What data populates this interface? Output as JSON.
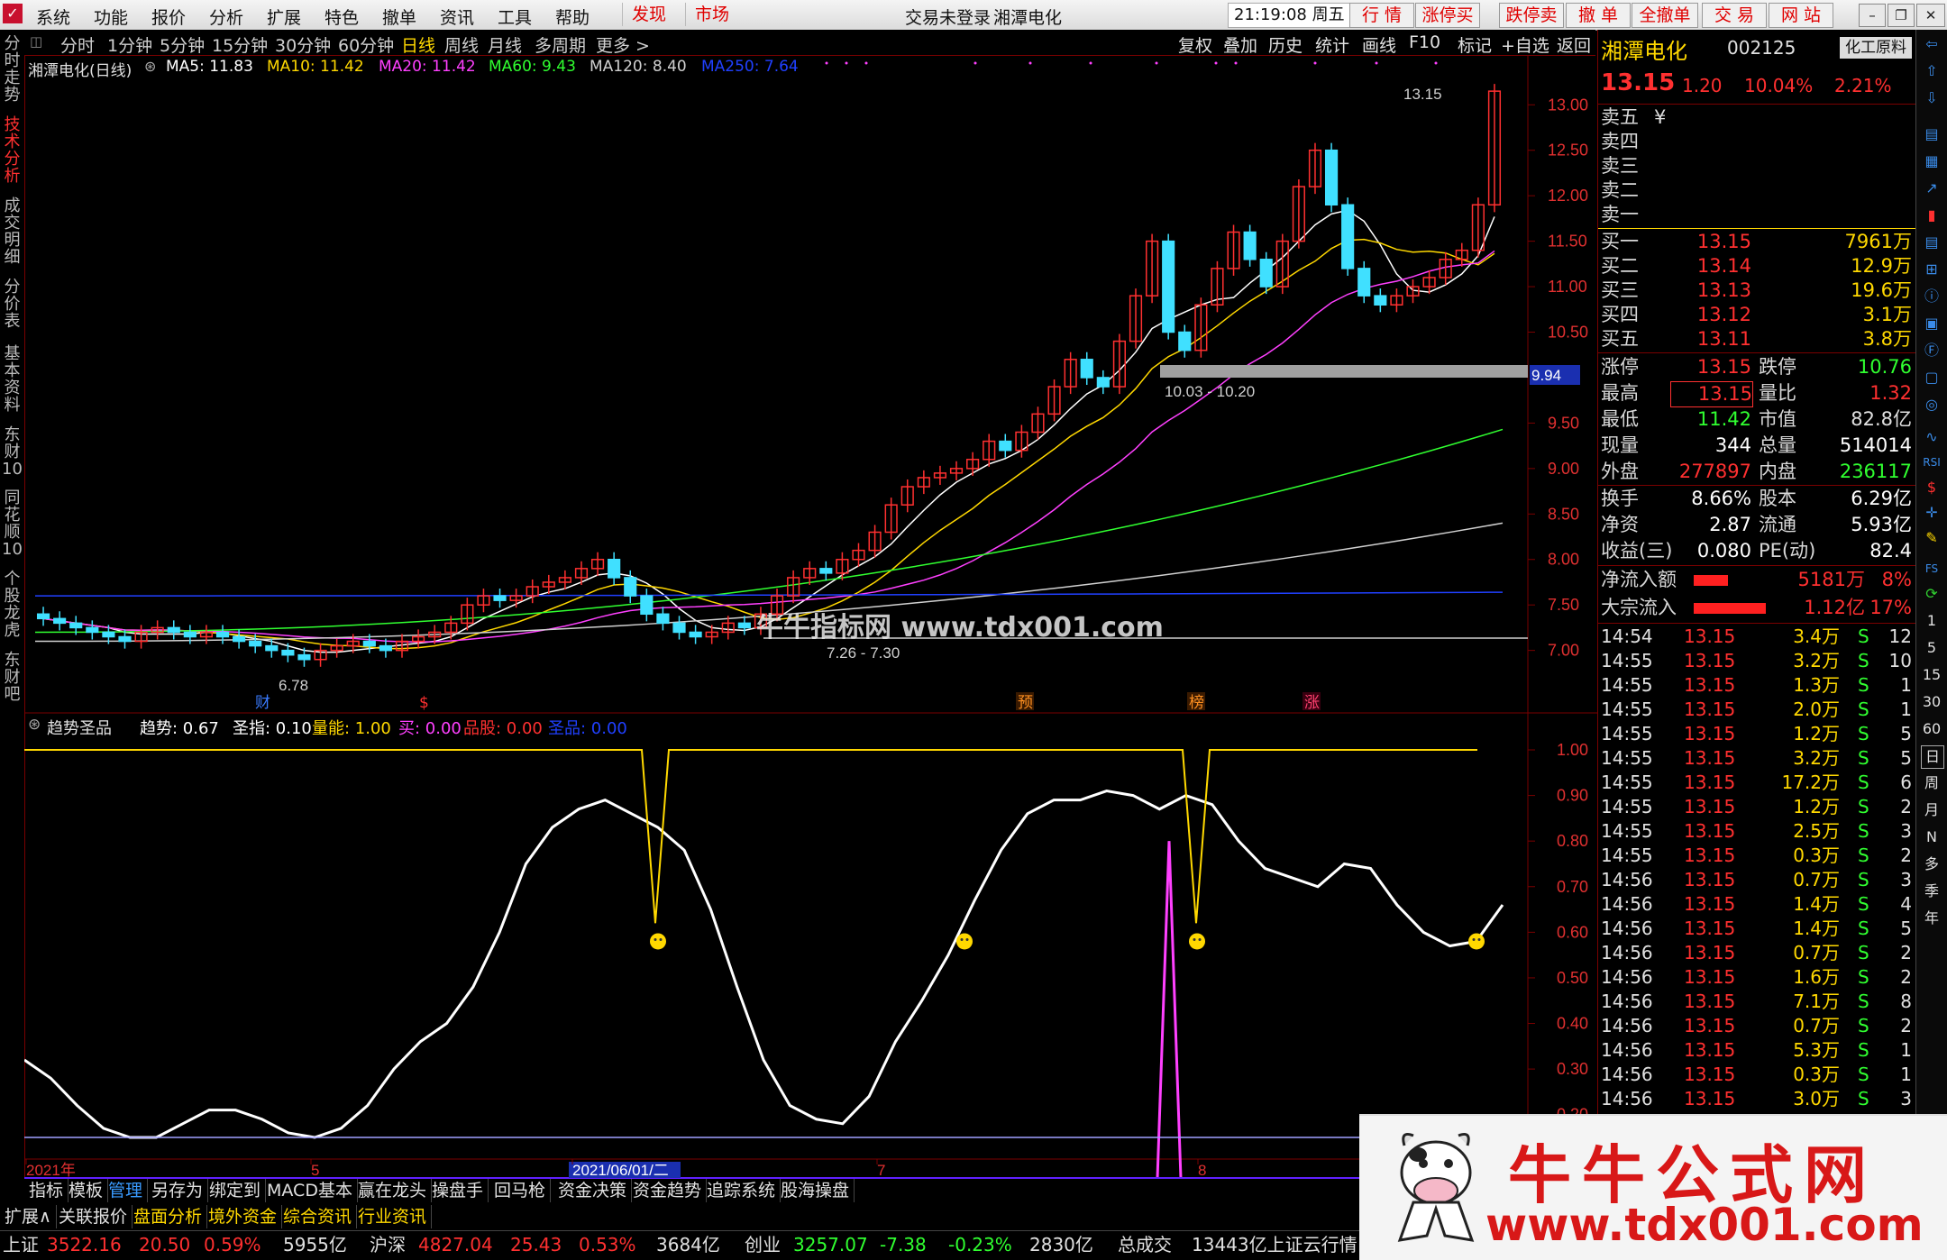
{
  "menubar": {
    "logo_icon": "app-logo-icon",
    "items": [
      "系统",
      "功能",
      "报价",
      "分析",
      "扩展",
      "特色",
      "撤单",
      "资讯",
      "工具",
      "帮助"
    ],
    "discover": "发现",
    "market": "市场",
    "login_status": "交易未登录",
    "stock_title": "湘潭电化",
    "datetime": "21:19:08 周五",
    "right_tabs": [
      "行 情",
      "涨停买",
      "跌停卖",
      "撤 单",
      "全撤单",
      "交 易",
      "网 站"
    ]
  },
  "left_tabs": [
    "分时走势",
    "技术分析",
    "成交明细",
    "分价表",
    "基本资料",
    "东财10",
    "同花顺10",
    "个股龙虎",
    "东财吧"
  ],
  "chart_toolbar": {
    "periods": [
      "分时",
      "1分钟",
      "5分钟",
      "15分钟",
      "30分钟",
      "60分钟",
      "日线",
      "周线",
      "月线",
      "多周期",
      "更多 >"
    ],
    "active_period": "日线",
    "tools": [
      "复权",
      "叠加",
      "历史",
      "统计",
      "画线",
      "F10",
      "标记",
      "+自选",
      "返回"
    ]
  },
  "main_chart": {
    "title": "湘潭电化(日线)",
    "ma": [
      {
        "label": "MA5: 11.83",
        "color": "#ffffff"
      },
      {
        "label": "MA10: 11.42",
        "color": "#ffd800"
      },
      {
        "label": "MA20: 11.42",
        "color": "#ff40ff"
      },
      {
        "label": "MA60: 9.43",
        "color": "#30ff30"
      },
      {
        "label": "MA120: 8.40",
        "color": "#d0d0d0"
      },
      {
        "label": "MA250: 7.64",
        "color": "#2040ff"
      }
    ],
    "high_label": "13.15",
    "low_label": "6.78",
    "range_label_1": "10.03 - 10.20",
    "range_label_2": "7.26 - 7.30",
    "price_tag": "9.94",
    "watermark": "牛牛指标网 www.tdx001.com",
    "markers": [
      "财",
      "$",
      "预",
      "榜",
      "涨"
    ]
  },
  "indicator": {
    "name": "趋势圣品",
    "values": [
      {
        "label": "趋势: 0.67",
        "color": "#ffffff"
      },
      {
        "label": "圣指: 0.10",
        "color": "#ffffff"
      },
      {
        "label": "量能: 1.00",
        "color": "#ffd800"
      },
      {
        "label": "买: 0.00",
        "color": "#ff40ff"
      },
      {
        "label": "品股: 0.00",
        "color": "#ff3030"
      },
      {
        "label": "圣品: 0.00",
        "color": "#2040ff"
      }
    ]
  },
  "chart_data": {
    "type": "candlestick",
    "title": "湘潭电化(日线)",
    "price_axis": [
      13.0,
      12.5,
      12.0,
      11.5,
      11.0,
      10.5,
      9.5,
      9.0,
      8.5,
      8.0,
      7.5,
      7.0
    ],
    "indicator_axis": [
      1.0,
      0.9,
      0.8,
      0.7,
      0.6,
      0.5,
      0.4,
      0.3,
      0.2
    ],
    "x_labels": [
      "2021年",
      "5",
      "2021/06/01/二",
      "7",
      "8"
    ],
    "ma_values": {
      "MA5": 11.83,
      "MA10": 11.42,
      "MA20": 11.42,
      "MA60": 9.43,
      "MA120": 8.4,
      "MA250": 7.64
    },
    "indicator_series": {
      "趋势": 0.67,
      "圣指": 0.1,
      "量能": 1.0,
      "买": 0.0,
      "品股": 0.0,
      "圣品": 0.0
    },
    "grid": false
  },
  "quote": {
    "name": "湘潭电化",
    "code": "002125",
    "sector": "化工原料",
    "price": "13.15",
    "change": "1.20",
    "pct": "10.04%",
    "extra_pct": "2.21%",
    "sell": [
      {
        "label": "卖五",
        "extra": "¥",
        "price": "",
        "vol": ""
      },
      {
        "label": "卖四",
        "price": "",
        "vol": ""
      },
      {
        "label": "卖三",
        "price": "",
        "vol": ""
      },
      {
        "label": "卖二",
        "price": "",
        "vol": ""
      },
      {
        "label": "卖一",
        "price": "",
        "vol": ""
      }
    ],
    "buy": [
      {
        "label": "买一",
        "price": "13.15",
        "vol": "7961万"
      },
      {
        "label": "买二",
        "price": "13.14",
        "vol": "12.9万"
      },
      {
        "label": "买三",
        "price": "13.13",
        "vol": "19.6万"
      },
      {
        "label": "买四",
        "price": "13.12",
        "vol": "3.1万"
      },
      {
        "label": "买五",
        "price": "13.11",
        "vol": "3.8万"
      }
    ],
    "stats": [
      {
        "l1": "涨停",
        "v1": "13.15",
        "c1": "#ff3030",
        "l2": "跌停",
        "v2": "10.76",
        "c2": "#30ff30"
      },
      {
        "l1": "最高",
        "v1": "13.15",
        "c1": "#ff3030",
        "l2": "量比",
        "v2": "1.32",
        "c2": "#ff3030"
      },
      {
        "l1": "最低",
        "v1": "11.42",
        "c1": "#30ff30",
        "l2": "市值",
        "v2": "82.8亿",
        "c2": "#e0e0e0"
      },
      {
        "l1": "现量",
        "v1": "344",
        "c1": "#ffffff",
        "l2": "总量",
        "v2": "514014",
        "c2": "#ffffff"
      },
      {
        "l1": "外盘",
        "v1": "277897",
        "c1": "#ff3030",
        "l2": "内盘",
        "v2": "236117",
        "c2": "#30ff30"
      }
    ],
    "stats2": [
      {
        "l1": "换手",
        "v1": "8.66%",
        "l2": "股本",
        "v2": "6.29亿"
      },
      {
        "l1": "净资",
        "v1": "2.87",
        "l2": "流通",
        "v2": "5.93亿"
      },
      {
        "l1": "收益(三)",
        "v1": "0.080",
        "l2": "PE(动)",
        "v2": "82.4"
      }
    ],
    "flow": [
      {
        "label": "净流入额",
        "value": "5181万",
        "pct": "8%",
        "bar": 0.08
      },
      {
        "label": "大宗流入",
        "value": "1.12亿",
        "pct": "17%",
        "bar": 0.17
      }
    ],
    "ticks": [
      {
        "t": "14:54",
        "p": "13.15",
        "v": "3.4万",
        "s": "S",
        "n": "12"
      },
      {
        "t": "14:55",
        "p": "13.15",
        "v": "3.2万",
        "s": "S",
        "n": "10"
      },
      {
        "t": "14:55",
        "p": "13.15",
        "v": "1.3万",
        "s": "S",
        "n": "1"
      },
      {
        "t": "14:55",
        "p": "13.15",
        "v": "2.0万",
        "s": "S",
        "n": "1"
      },
      {
        "t": "14:55",
        "p": "13.15",
        "v": "1.2万",
        "s": "S",
        "n": "5"
      },
      {
        "t": "14:55",
        "p": "13.15",
        "v": "3.2万",
        "s": "S",
        "n": "5"
      },
      {
        "t": "14:55",
        "p": "13.15",
        "v": "17.2万",
        "s": "S",
        "n": "6"
      },
      {
        "t": "14:55",
        "p": "13.15",
        "v": "1.2万",
        "s": "S",
        "n": "2"
      },
      {
        "t": "14:55",
        "p": "13.15",
        "v": "2.5万",
        "s": "S",
        "n": "3"
      },
      {
        "t": "14:55",
        "p": "13.15",
        "v": "0.3万",
        "s": "S",
        "n": "2"
      },
      {
        "t": "14:56",
        "p": "13.15",
        "v": "0.7万",
        "s": "S",
        "n": "3"
      },
      {
        "t": "14:56",
        "p": "13.15",
        "v": "1.4万",
        "s": "S",
        "n": "4"
      },
      {
        "t": "14:56",
        "p": "13.15",
        "v": "1.4万",
        "s": "S",
        "n": "5"
      },
      {
        "t": "14:56",
        "p": "13.15",
        "v": "0.7万",
        "s": "S",
        "n": "2"
      },
      {
        "t": "14:56",
        "p": "13.15",
        "v": "1.6万",
        "s": "S",
        "n": "2"
      },
      {
        "t": "14:56",
        "p": "13.15",
        "v": "7.1万",
        "s": "S",
        "n": "8"
      },
      {
        "t": "14:56",
        "p": "13.15",
        "v": "0.7万",
        "s": "S",
        "n": "2"
      },
      {
        "t": "14:56",
        "p": "13.15",
        "v": "5.3万",
        "s": "S",
        "n": "1"
      },
      {
        "t": "14:56",
        "p": "13.15",
        "v": "0.3万",
        "s": "S",
        "n": "1"
      },
      {
        "t": "14:56",
        "p": "13.15",
        "v": "3.0万",
        "s": "S",
        "n": "3"
      }
    ]
  },
  "right_tools": [
    "日",
    "周",
    "月",
    "N",
    "多",
    "季",
    "年",
    "1",
    "5",
    "15",
    "30",
    "60"
  ],
  "bottom_tabs1": [
    "指标",
    "模板",
    "管理",
    "另存为",
    "绑定到",
    "MACD基本",
    "赢在龙头",
    "操盘手",
    "回马枪",
    "资金决策",
    "资金趋势",
    "追踪系统",
    "股海操盘"
  ],
  "bottom_tabs2": [
    "扩展∧",
    "关联报价",
    "盘面分析",
    "境外资金",
    "综合资讯",
    "行业资讯"
  ],
  "status": {
    "sh_label": "上证",
    "sh": "3522.16",
    "sh_chg": "20.50",
    "sh_pct": "0.59%",
    "sh_amt": "5955亿",
    "hs_label": "沪深",
    "hs": "4827.04",
    "hs_chg": "25.43",
    "hs_pct": "0.53%",
    "hs_amt": "3684亿",
    "cy_label": "创业",
    "cy": "3257.07",
    "cy_chg": "-7.38",
    "cy_pct": "-0.23%",
    "cy_amt": "2830亿",
    "total_label": "总成交",
    "total": "13443亿上证云行情"
  },
  "ad": {
    "title": "牛牛公式网",
    "url": "www.tdx001.com"
  }
}
